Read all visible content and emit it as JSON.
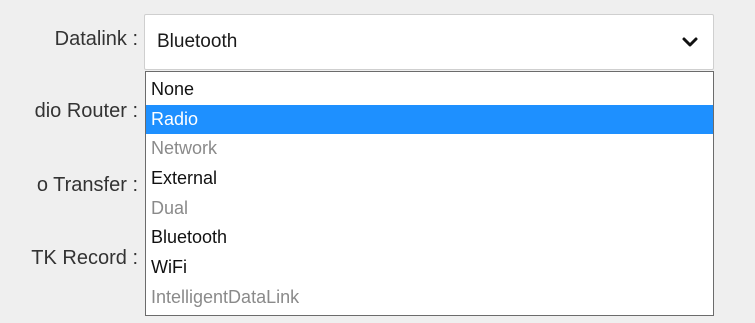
{
  "form": {
    "datalink_label": "Datalink :",
    "radio_router_label": "dio Router :",
    "auto_transfer_label": "o Transfer :",
    "rtk_record_label": "TK Record :"
  },
  "select": {
    "current_value": "Bluetooth",
    "chevron_icon": "chevron-down-icon"
  },
  "dropdown": {
    "options": [
      {
        "label": "None",
        "state": "enabled"
      },
      {
        "label": "Radio",
        "state": "highlighted"
      },
      {
        "label": "Network",
        "state": "disabled"
      },
      {
        "label": "External",
        "state": "enabled"
      },
      {
        "label": "Dual",
        "state": "disabled"
      },
      {
        "label": "Bluetooth",
        "state": "enabled"
      },
      {
        "label": "WiFi",
        "state": "enabled"
      },
      {
        "label": "IntelligentDataLink",
        "state": "disabled"
      }
    ]
  },
  "colors": {
    "highlight": "#1e90ff",
    "disabled_text": "#8a8a8a",
    "background": "#efefef"
  }
}
